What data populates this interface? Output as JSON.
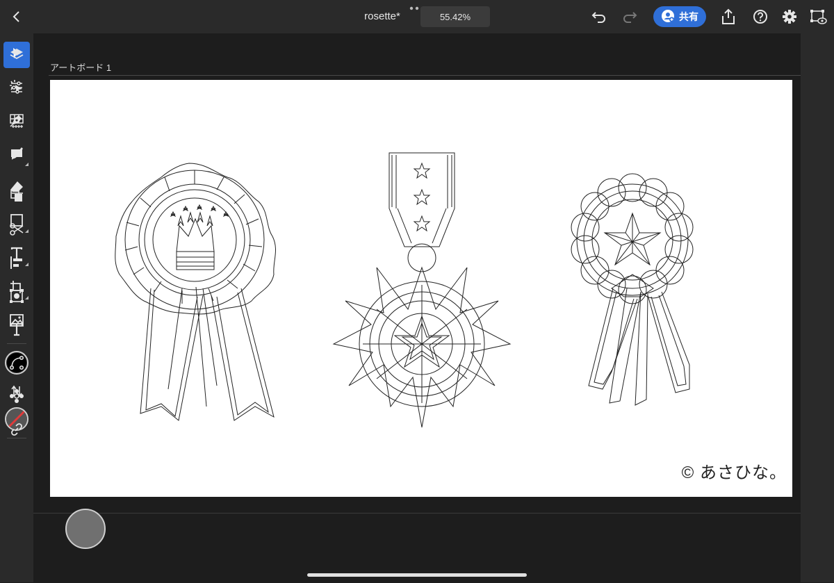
{
  "header": {
    "title": "rosette*",
    "zoom": "55.42%",
    "share_label": "共有"
  },
  "left_tools": [
    {
      "name": "select-tool",
      "icon": "arrow-pointer-icon",
      "active": true
    },
    {
      "name": "direct-select-tool",
      "icon": "magic-select-icon"
    },
    {
      "name": "pen-tool",
      "icon": "pen-icon"
    },
    {
      "name": "brush-tool",
      "icon": "brush-icon"
    },
    {
      "name": "eraser-tool",
      "icon": "eraser-icon"
    },
    {
      "name": "shape-tool",
      "icon": "rectangle-icon"
    },
    {
      "name": "type-tool",
      "icon": "type-icon"
    },
    {
      "name": "transform-tool",
      "icon": "transform-icon"
    },
    {
      "name": "image-tool",
      "icon": "image-icon"
    }
  ],
  "colors": {
    "fill": "#000000",
    "stroke_none": "#e03a3a",
    "accent": "#2f6fd8",
    "toolbar": "#2a2a2a",
    "canvas_bg": "#1d1d1d"
  },
  "right_tools": [
    "layers-icon",
    "properties-icon",
    "grid-icon",
    "comment-icon",
    "arrange-icon",
    "scissors-icon",
    "align-icon",
    "repeat-icon",
    "type-icon",
    "path-icon",
    "pattern-icon",
    "link-icon"
  ],
  "artboard": {
    "label": "アートボード 1",
    "copyright": "© あさひな。"
  }
}
